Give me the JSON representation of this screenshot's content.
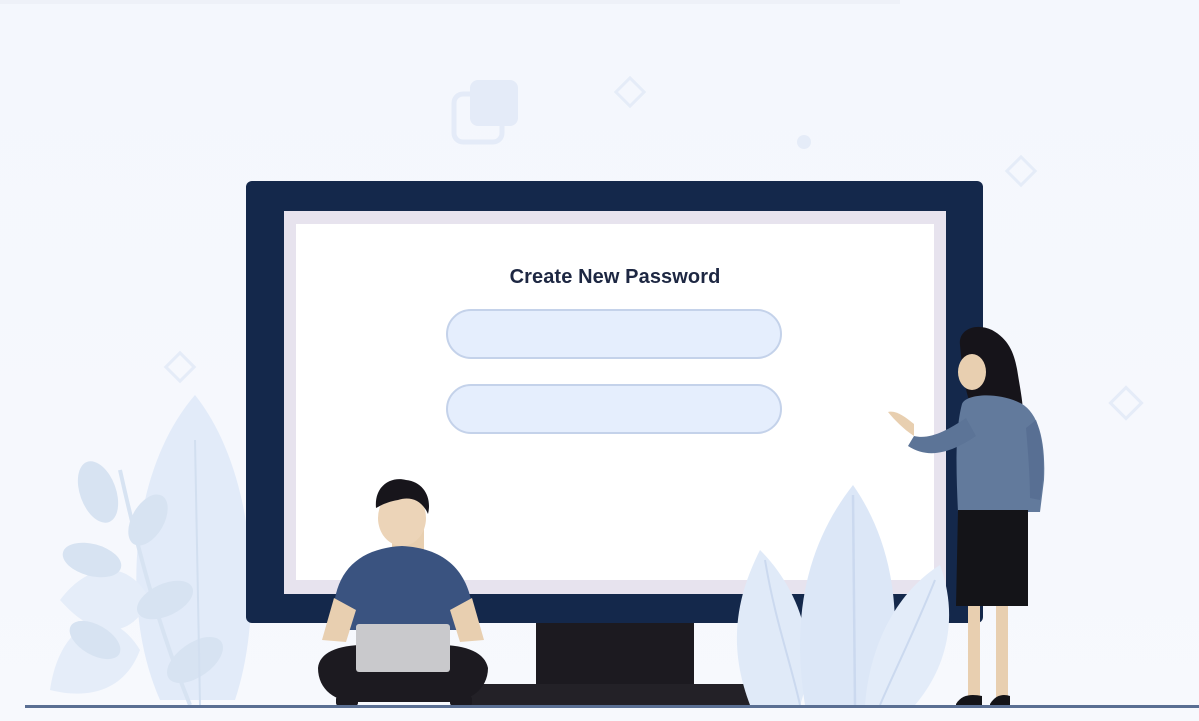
{
  "form": {
    "title": "Create New Password",
    "new_password_value": "",
    "confirm_password_value": ""
  },
  "colors": {
    "background": "#f5f7fc",
    "monitor_frame": "#14284b",
    "screen_border": "#e7e3ee",
    "screen": "#ffffff",
    "field_fill": "#e5eefd",
    "field_border": "#c4d2ea",
    "title_text": "#1d2742",
    "man_shirt": "#3a5380",
    "woman_blouse": "#627a9c",
    "woman_skirt": "#141418",
    "foliage": "#dde8f7",
    "ground_line": "#5a6f93"
  },
  "icons": {
    "decoration_squares": "stacked-squares-icon",
    "decoration_diamond": "diamond-outline-icon",
    "decoration_dot": "dot-icon"
  }
}
